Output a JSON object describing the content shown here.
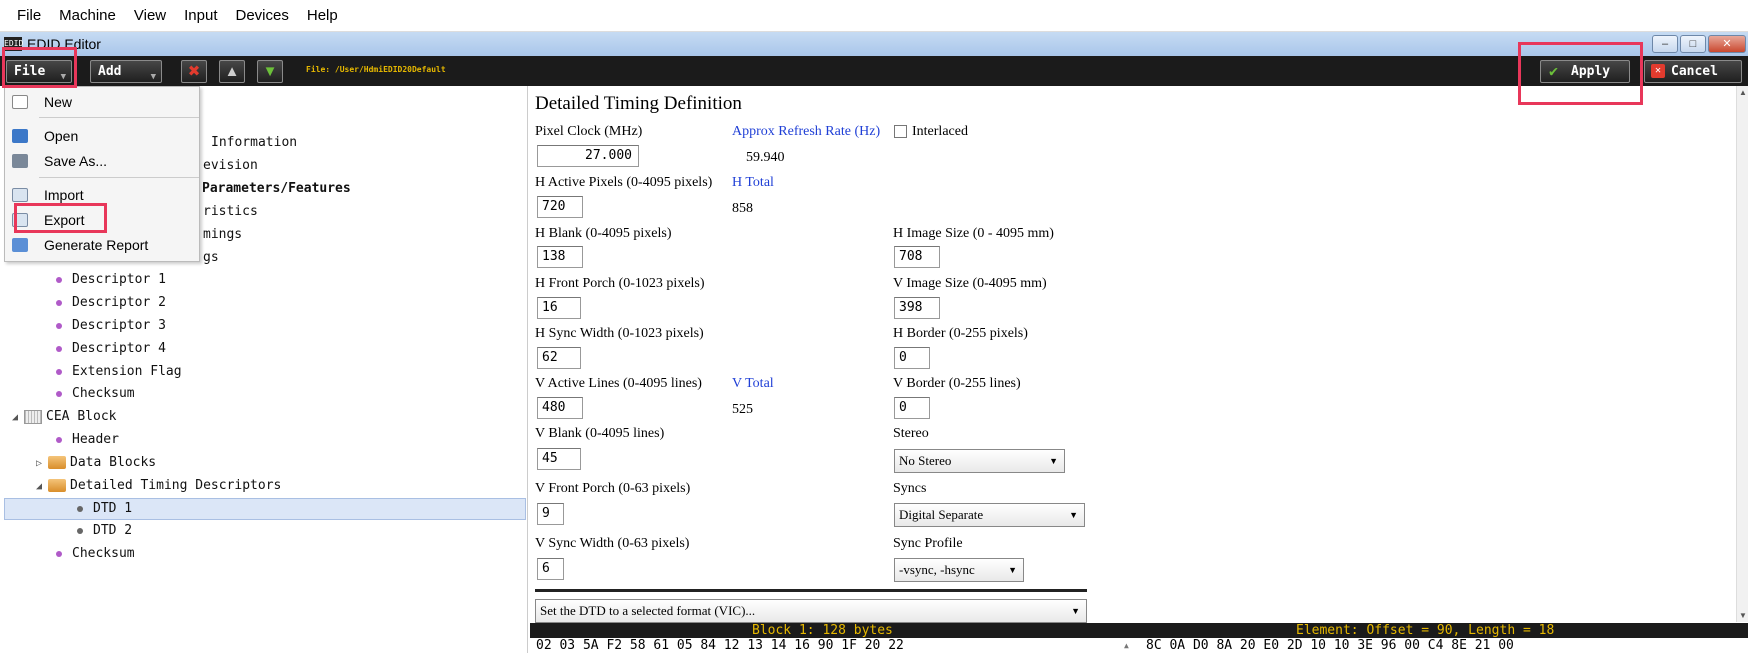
{
  "menubar": [
    "File",
    "Machine",
    "View",
    "Input",
    "Devices",
    "Help"
  ],
  "window": {
    "icon_text": "EDID",
    "title": "EDID Editor"
  },
  "toolbar": {
    "file_label": "File",
    "add_label": "Add",
    "file_path": "File: /User/HdmiEDID20Default",
    "apply_label": "Apply",
    "cancel_label": "Cancel"
  },
  "file_menu": {
    "new": "New",
    "open": "Open",
    "save_as": "Save As...",
    "import": "Import",
    "export": "Export",
    "generate_report": "Generate Report"
  },
  "tree": {
    "partial": [
      "Information",
      "evision",
      "Parameters/Features",
      "ristics",
      "mings",
      "gs"
    ],
    "base_items": [
      "Descriptor 1",
      "Descriptor 2",
      "Descriptor 3",
      "Descriptor 4",
      "Extension Flag",
      "Checksum"
    ],
    "cea_block": "CEA Block",
    "cea_header": "Header",
    "data_blocks": "Data Blocks",
    "dtd_group": "Detailed Timing Descriptors",
    "dtd1": "DTD 1",
    "dtd2": "DTD 2",
    "cea_checksum": "Checksum"
  },
  "form": {
    "heading": "Detailed Timing Definition",
    "pixel_clock_label": "Pixel Clock (MHz)",
    "pixel_clock": "27.000",
    "refresh_label": "Approx Refresh Rate (Hz)",
    "refresh": "59.940",
    "interlaced_label": "Interlaced",
    "h_active_label": "H Active Pixels (0-4095 pixels)",
    "h_active": "720",
    "h_total_label": "H Total",
    "h_total": "858",
    "h_blank_label": "H Blank (0-4095 pixels)",
    "h_blank": "138",
    "h_image_label": "H Image Size (0 - 4095 mm)",
    "h_image": "708",
    "h_front_label": "H Front Porch (0-1023 pixels)",
    "h_front": "16",
    "v_image_label": "V Image Size (0-4095 mm)",
    "v_image": "398",
    "h_sync_label": "H Sync Width (0-1023 pixels)",
    "h_sync": "62",
    "h_border_label": "H Border (0-255 pixels)",
    "h_border": "0",
    "v_active_label": "V Active Lines (0-4095 lines)",
    "v_active": "480",
    "v_total_label": "V Total",
    "v_total": "525",
    "v_border_label": "V Border (0-255 lines)",
    "v_border": "0",
    "v_blank_label": "V Blank (0-4095 lines)",
    "v_blank": "45",
    "stereo_label": "Stereo",
    "stereo": "No Stereo",
    "v_front_label": "V Front Porch (0-63 pixels)",
    "v_front": "9",
    "syncs_label": "Syncs",
    "syncs": "Digital Separate",
    "v_sync_label": "V Sync Width (0-63 pixels)",
    "v_sync": "6",
    "sync_profile_label": "Sync Profile",
    "sync_profile": "-vsync, -hsync",
    "vic_select": "Set the DTD to a selected format (VIC)..."
  },
  "status": {
    "block": "Block 1: 128 bytes",
    "element": "Element: Offset = 90, Length = 18",
    "hex_left": "02 03 5A F2 58 61 05 84 12 13 14 16 90 1F 20 22",
    "hex_right": "8C 0A D0 8A 20 E0 2D 10 10 3E 96 00 C4 8E 21 00"
  },
  "colors": {
    "accent_highlight": "#e8375a",
    "toolbar_bg": "#1b1b1b",
    "status_text": "#e6b800",
    "link_blue": "#1f3fd6"
  }
}
